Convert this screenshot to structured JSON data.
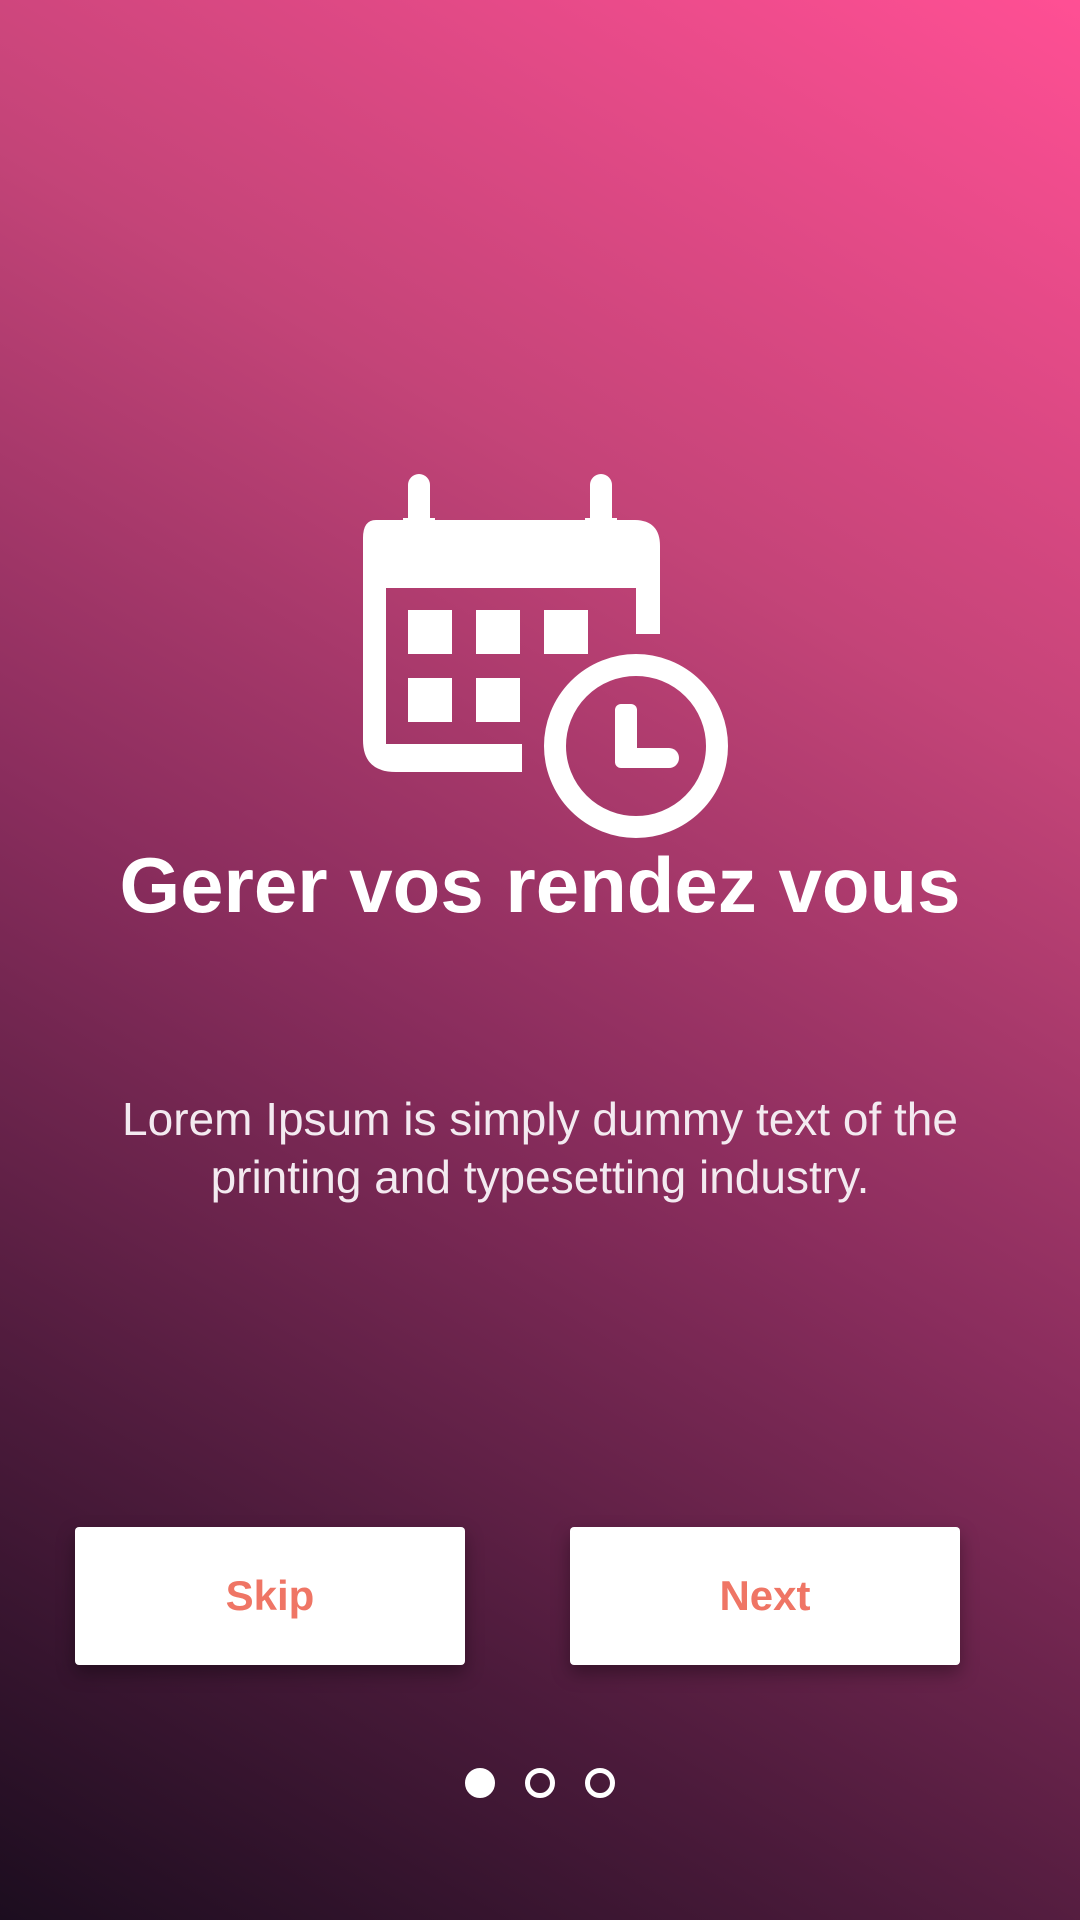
{
  "onboarding": {
    "icon": "calendar-clock-icon",
    "title": "Gerer vos rendez vous",
    "description": "Lorem Ipsum is simply dummy text of the printing and typesetting industry."
  },
  "actions": {
    "skip_label": "Skip",
    "next_label": "Next"
  },
  "pagination": {
    "total_pages": 3,
    "current_page": 1
  },
  "colors": {
    "gradient_top_right": "#ff4f94",
    "gradient_bottom_left": "#1c0d1f",
    "button_text": "#ef7565",
    "button_background": "#ffffff"
  }
}
